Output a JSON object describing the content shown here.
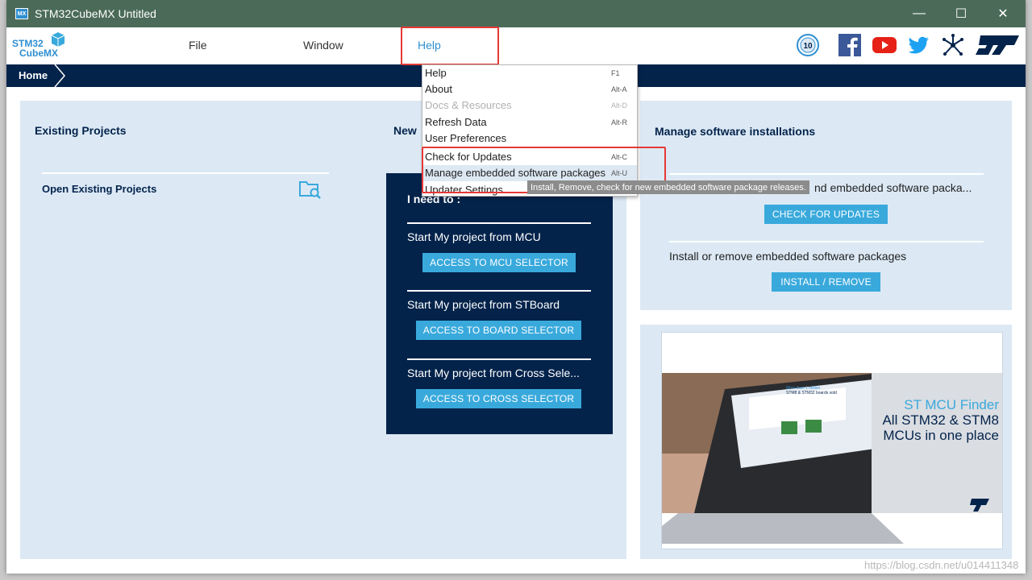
{
  "window": {
    "title": "STM32CubeMX Untitled",
    "app_icon_text": "MX",
    "minimize_glyph": "—",
    "maximize_glyph": "☐",
    "close_glyph": "✕"
  },
  "logo": {
    "line1": "STM32",
    "line2": "CubeMX"
  },
  "menubar": {
    "file": "File",
    "window": "Window",
    "help": "Help"
  },
  "social_icons": [
    "anniversary-badge-icon",
    "facebook-icon",
    "youtube-icon",
    "twitter-icon",
    "network-share-icon",
    "st-logo-icon"
  ],
  "breadcrumb": {
    "home": "Home"
  },
  "existing_projects": {
    "heading": "Existing Projects",
    "open_label": "Open Existing Projects"
  },
  "new_project": {
    "heading_partial": "New",
    "need_to": "I need to :",
    "rows": [
      {
        "label": "Start My project from MCU",
        "button": "ACCESS TO MCU SELECTOR"
      },
      {
        "label": "Start My project from STBoard",
        "button": "ACCESS TO BOARD SELECTOR"
      },
      {
        "label": "Start My project from Cross Sele...",
        "button": "ACCESS TO CROSS SELECTOR"
      }
    ]
  },
  "software": {
    "heading": "Manage software installations",
    "check_text": "nd embedded software packa...",
    "check_button": "CHECK FOR UPDATES",
    "install_text": "Install or remove embedded software packages",
    "install_button": "INSTALL / REMOVE"
  },
  "banner": {
    "line1": "ST MCU Finder",
    "line2": "All STM32 & STM8",
    "line3": "MCUs in one place",
    "screen_title": "More than 1 million",
    "screen_sub": "STM8 & STM32 boards sold"
  },
  "help_menu": {
    "items": [
      {
        "label": "Help",
        "shortcut": "F1",
        "disabled": false
      },
      {
        "label": "About",
        "shortcut": "Alt-A",
        "disabled": false
      },
      {
        "label": "Docs & Resources",
        "shortcut": "Alt-D",
        "disabled": true
      },
      {
        "label": "Refresh Data",
        "shortcut": "Alt-R",
        "disabled": false
      },
      {
        "label": "User Preferences",
        "shortcut": "",
        "disabled": false
      },
      {
        "label": "Check for Updates",
        "shortcut": "Alt-C",
        "disabled": false
      },
      {
        "label": "Manage embedded software packages",
        "shortcut": "Alt-U",
        "disabled": false
      },
      {
        "label": "Updater Settings ...",
        "shortcut": "",
        "disabled": false
      }
    ]
  },
  "tooltip": "Install, Remove, check for new embedded software package releases.",
  "watermark": "https://blog.csdn.net/u014411348",
  "colors": {
    "titlebar": "#4b6b58",
    "navy": "#03234b",
    "accent": "#39a9dc",
    "panel": "#dce9f5",
    "highlight": "#e53935"
  }
}
